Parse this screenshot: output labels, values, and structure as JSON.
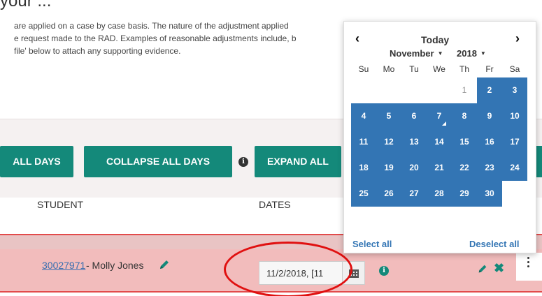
{
  "page": {
    "heading_fragment": "your ...",
    "intro_lines": [
      "are applied on a case by case basis. The nature of the adjustment applied",
      "e request made to the RAD. Examples of reasonable adjustments include, b",
      "file' below to attach any supporting evidence."
    ]
  },
  "toolbar": {
    "expand_days_label": "ALL DAYS",
    "collapse_days_label": "COLLAPSE ALL DAYS",
    "info_icon": "info-circle-icon",
    "expand_all_label": "EXPAND ALL"
  },
  "table": {
    "columns": [
      "STUDENT",
      "DATES"
    ],
    "row": {
      "student_id": "30027971",
      "student_name": " - Molly Jones",
      "dates_value": "11/2/2018, [11",
      "calendar_icon": "calendar-icon",
      "info_icon": "info-circle-icon",
      "edit_icon": "pencil-icon",
      "delete_icon": "x-icon",
      "delete_glyph": "✖",
      "more_icon": "kebab-menu-icon"
    }
  },
  "datepicker": {
    "prev": "‹",
    "next": "›",
    "today_label": "Today",
    "month": "November",
    "year": "2018",
    "weekdays": [
      "Su",
      "Mo",
      "Tu",
      "We",
      "Th",
      "Fr",
      "Sa"
    ],
    "days": [
      {
        "label": "",
        "state": "empty"
      },
      {
        "label": "",
        "state": "empty"
      },
      {
        "label": "",
        "state": "empty"
      },
      {
        "label": "",
        "state": "empty"
      },
      {
        "label": "1",
        "state": "other"
      },
      {
        "label": "2",
        "state": "selected"
      },
      {
        "label": "3",
        "state": "selected"
      },
      {
        "label": "4",
        "state": "selected"
      },
      {
        "label": "5",
        "state": "selected"
      },
      {
        "label": "6",
        "state": "selected"
      },
      {
        "label": "7",
        "state": "selected-today"
      },
      {
        "label": "8",
        "state": "selected"
      },
      {
        "label": "9",
        "state": "selected"
      },
      {
        "label": "10",
        "state": "selected"
      },
      {
        "label": "11",
        "state": "selected"
      },
      {
        "label": "12",
        "state": "selected"
      },
      {
        "label": "13",
        "state": "selected"
      },
      {
        "label": "14",
        "state": "selected"
      },
      {
        "label": "15",
        "state": "selected"
      },
      {
        "label": "16",
        "state": "selected"
      },
      {
        "label": "17",
        "state": "selected"
      },
      {
        "label": "18",
        "state": "selected"
      },
      {
        "label": "19",
        "state": "selected"
      },
      {
        "label": "20",
        "state": "selected"
      },
      {
        "label": "21",
        "state": "selected"
      },
      {
        "label": "22",
        "state": "selected"
      },
      {
        "label": "23",
        "state": "selected"
      },
      {
        "label": "24",
        "state": "selected"
      },
      {
        "label": "25",
        "state": "selected"
      },
      {
        "label": "26",
        "state": "selected"
      },
      {
        "label": "27",
        "state": "selected"
      },
      {
        "label": "28",
        "state": "selected"
      },
      {
        "label": "29",
        "state": "selected"
      },
      {
        "label": "30",
        "state": "selected"
      },
      {
        "label": "",
        "state": "empty"
      }
    ],
    "select_all_label": "Select all",
    "deselect_all_label": "Deselect all"
  },
  "colors": {
    "teal": "#14897a",
    "selected_blue": "#3375b4",
    "row_red": "#f2bcbc",
    "annotation_red": "#e01010"
  }
}
